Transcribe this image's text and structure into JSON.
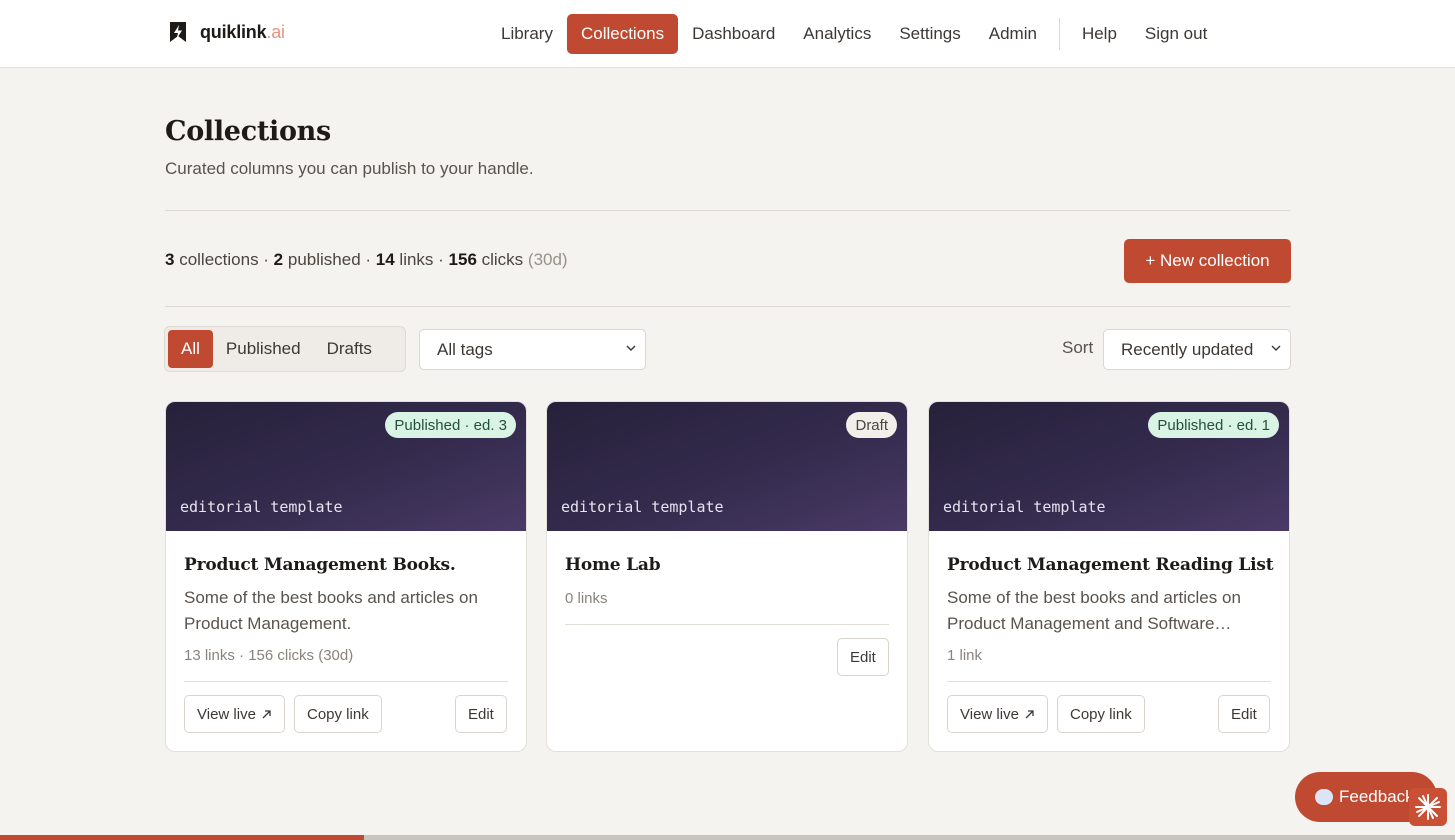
{
  "brand": {
    "name": "quiklink",
    "tld": ".ai"
  },
  "nav": {
    "items": [
      "Library",
      "Collections",
      "Dashboard",
      "Analytics",
      "Settings",
      "Admin"
    ],
    "active": "Collections",
    "secondary": [
      "Help",
      "Sign out"
    ]
  },
  "page": {
    "title": "Collections",
    "subtitle": "Curated columns you can publish to your handle."
  },
  "stats": {
    "collections_count": "3",
    "collections_label": " collections · ",
    "published_count": "2",
    "published_label": " published · ",
    "links_count": "14",
    "links_label": " links · ",
    "clicks_count": "156",
    "clicks_label": " clicks ",
    "period": "(30d)"
  },
  "actions": {
    "new_collection": "+ New collection"
  },
  "filters": {
    "segments": [
      "All",
      "Published",
      "Drafts"
    ],
    "active_segment": "All",
    "tags_value": "All tags",
    "sort_label": "Sort",
    "sort_value": "Recently updated"
  },
  "cards": [
    {
      "banner_label": "editorial template",
      "badge": "Published · ed. 3",
      "title": "Product Management Books.",
      "description": "Some of the best books and articles on Product Management.",
      "meta": "13 links · 156 clicks (30d)",
      "view_live": "View live",
      "copy_link": "Copy link",
      "edit": "Edit"
    },
    {
      "banner_label": "editorial template",
      "badge": "Draft",
      "title": "Home Lab",
      "meta": "0 links",
      "edit": "Edit"
    },
    {
      "banner_label": "editorial template",
      "badge": "Published · ed. 1",
      "title": "Product Management Reading List",
      "description": "Some of the best books and articles on Product Management and Software…",
      "meta": "1 link",
      "view_live": "View live",
      "copy_link": "Copy link",
      "edit": "Edit"
    }
  ],
  "feedback": {
    "label": "Feedback"
  },
  "colors": {
    "accent": "#bf4a31",
    "background": "#f5f3ef",
    "banner": "#342b4d",
    "badge_published": "#d9f3e4"
  }
}
